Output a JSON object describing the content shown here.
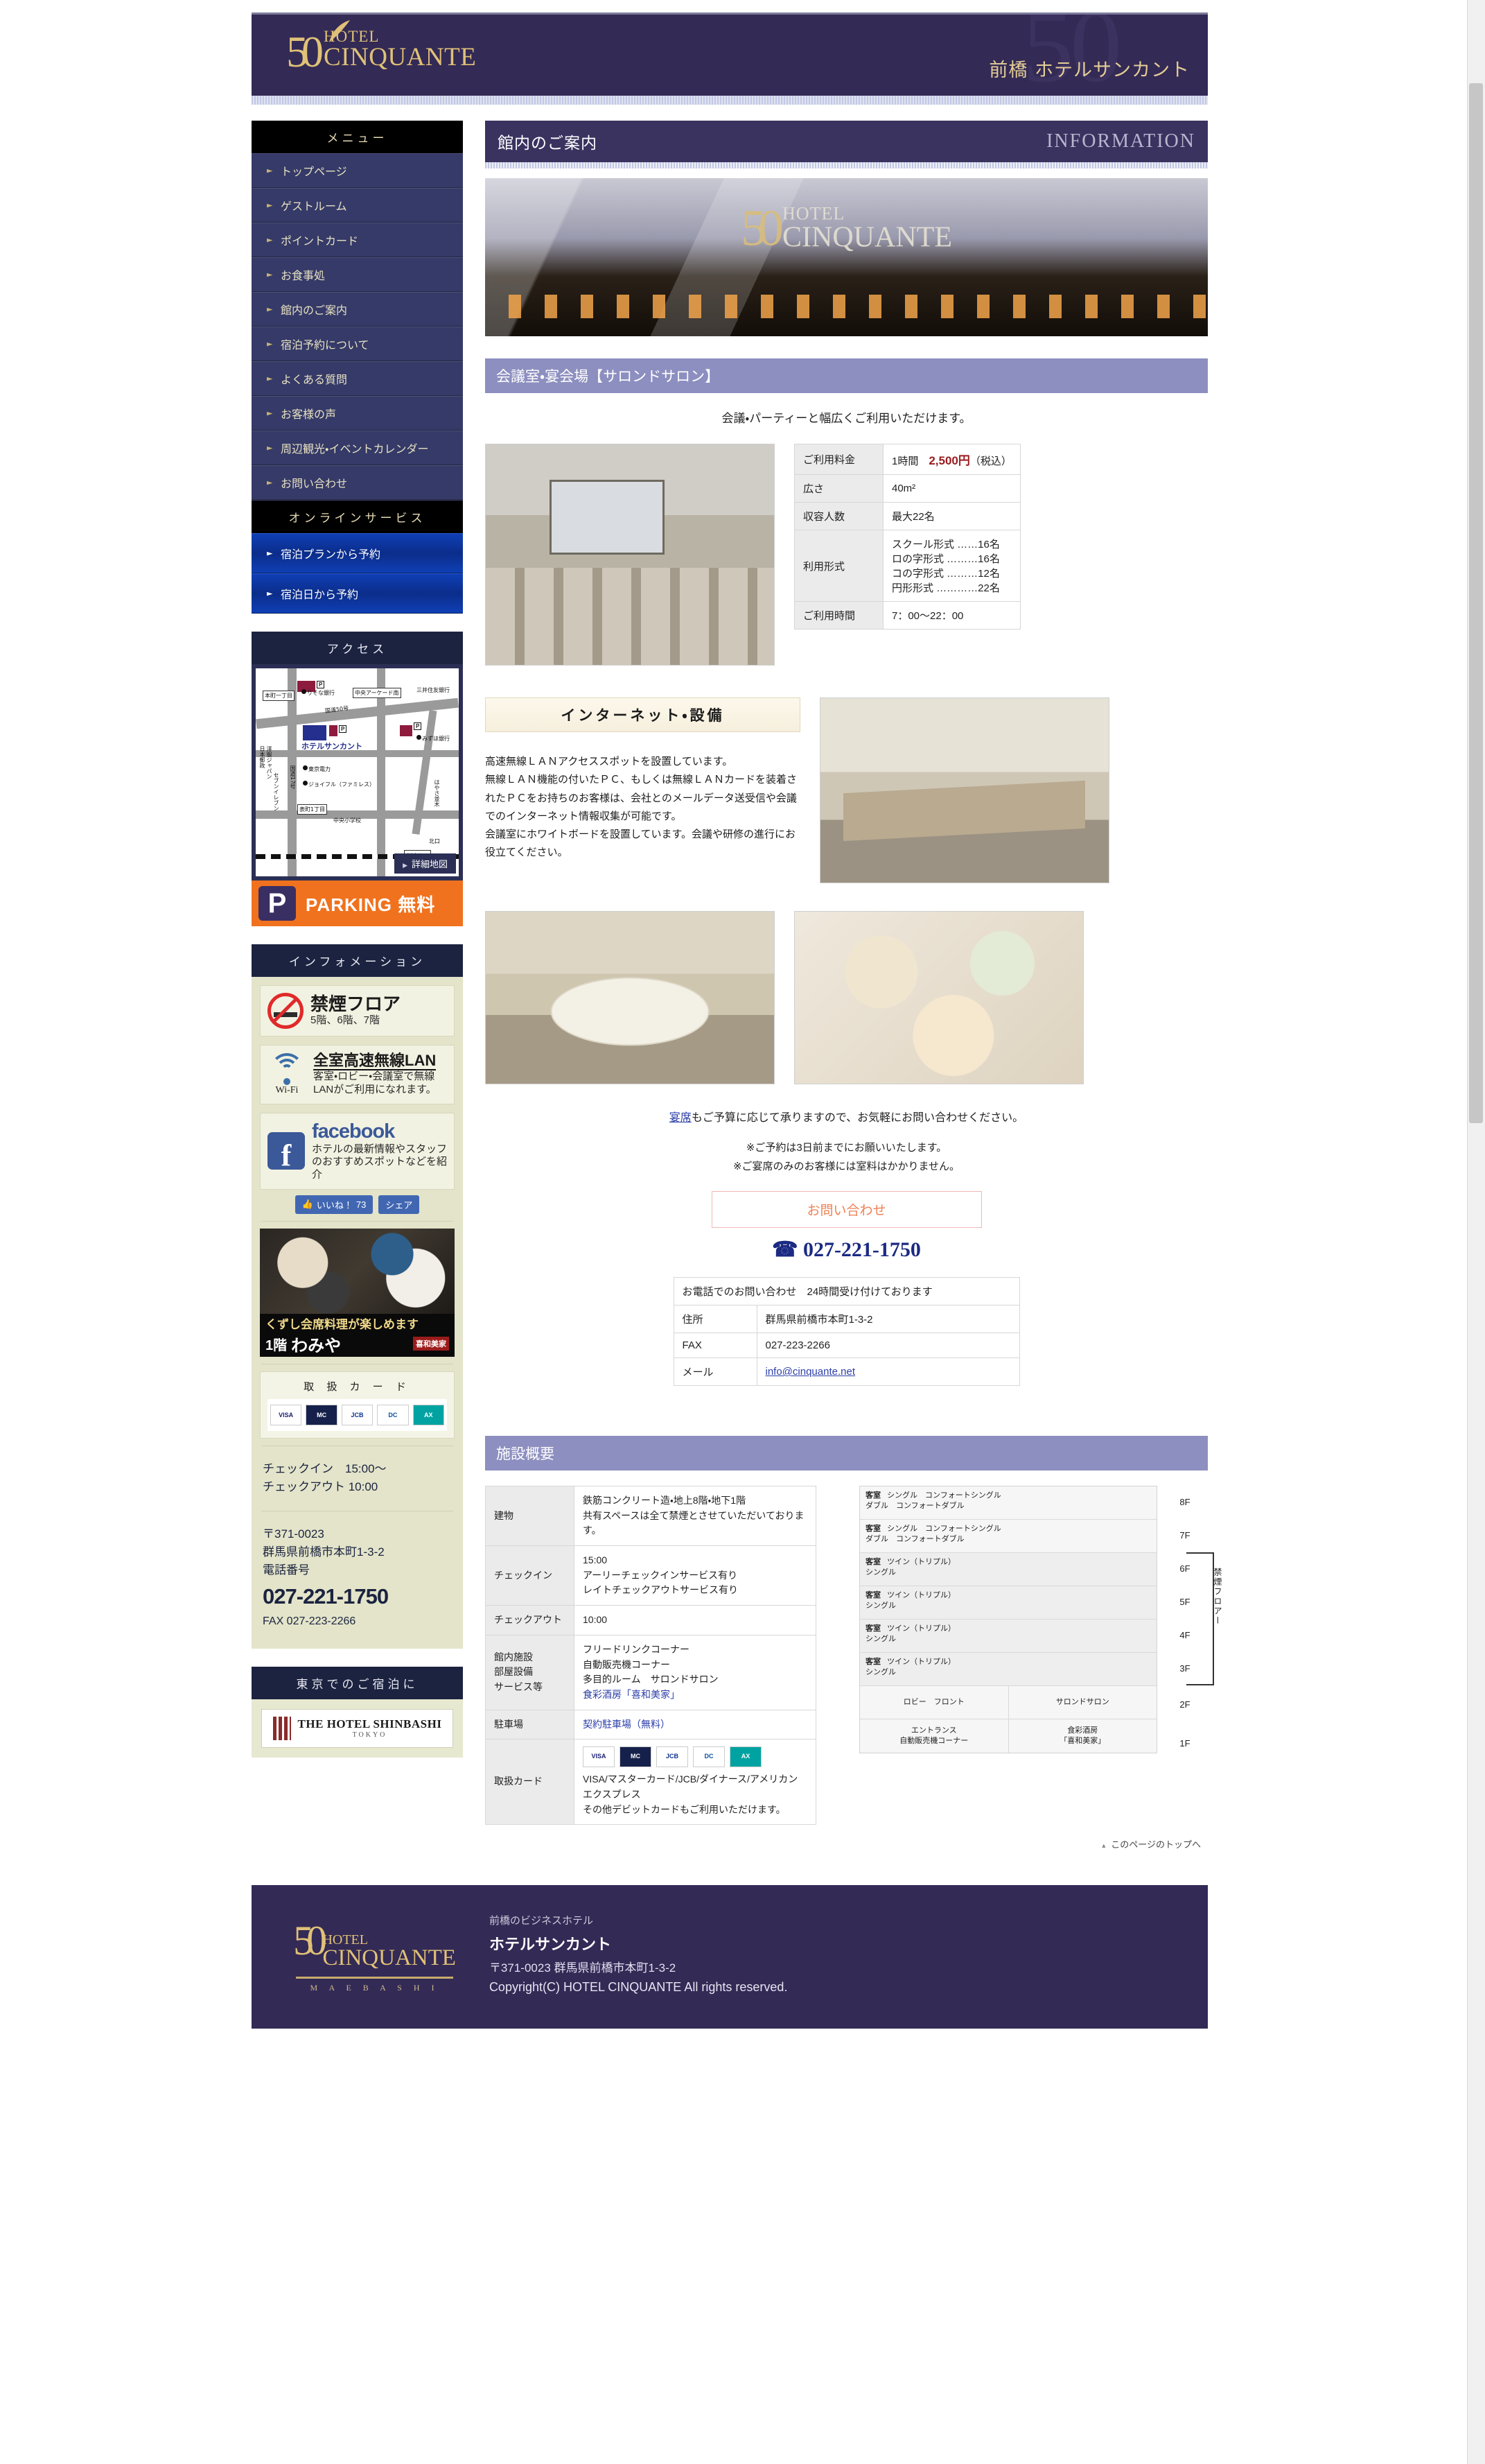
{
  "header": {
    "logo_line1": "HOTEL",
    "logo_line2": "CINQUANTE",
    "logo_mark": "50",
    "title": "前橋 ホテルサンカント"
  },
  "sidebar": {
    "menu_heading": "メニュー",
    "menu_items": [
      {
        "label": "トップページ"
      },
      {
        "label": "ゲストルーム"
      },
      {
        "label": "ポイントカード"
      },
      {
        "label": "お食事処"
      },
      {
        "label": "館内のご案内"
      },
      {
        "label": "宿泊予約について"
      },
      {
        "label": "よくある質問"
      },
      {
        "label": "お客様の声"
      },
      {
        "label": "周辺観光・イベントカレンダー"
      },
      {
        "label": "お問い合わせ"
      }
    ],
    "online_heading": "オンラインサービス",
    "online_items": [
      {
        "label": "宿泊プランから予約"
      },
      {
        "label": "宿泊日から予約"
      }
    ],
    "access_heading": "アクセス",
    "map": {
      "hotel_label": "ホテルサンカント",
      "labels": [
        "本町一丁目",
        "りそな銀行",
        "中央アーケード南",
        "三井住友銀行",
        "みずほ銀行",
        "国道50号",
        "国道17号",
        "東京電力",
        "ジョイフル（ファミレス）",
        "表町1丁目",
        "中央小学校",
        "前橋駅",
        "北口",
        "はやさ並木",
        "洋服ジャパン",
        "日本郵政",
        "セブンイレブン"
      ],
      "detail_button": "詳細地図",
      "parking_p": "P",
      "parking_label": "PARKING 無料"
    },
    "information_heading": "インフォメーション",
    "info_cards": [
      {
        "title": "禁煙フロア",
        "sub": "5階、6階、7階",
        "icon": "no-smoking-icon"
      },
      {
        "title": "全室高速無線LAN",
        "sub": "客室・ロビー・会議室で無線LANがご利用になれます。",
        "icon": "wifi-icon",
        "icon_label": "Wi-Fi"
      },
      {
        "title": "facebook",
        "sub": "ホテルの最新情報やスタッフのおすすめスポットなどを紹介",
        "icon": "facebook-icon"
      }
    ],
    "facebook_actions": {
      "like": "いいね！",
      "like_count": "73",
      "share": "シェア"
    },
    "promo": {
      "line1": "くずし会席料理が楽しめます",
      "floor": "1階",
      "shop": "わみや",
      "badge": "喜和美家"
    },
    "cards_heading": "取 扱 カ ー ド",
    "card_brands": [
      "VISA",
      "MasterCard",
      "JCB",
      "Diners Club",
      "AMEX"
    ],
    "checkin_line": "チェックイン　15:00～",
    "checkout_line": "チェックアウト 10:00",
    "postal": "〒371-0023",
    "address": "群馬県前橋市本町1-3-2",
    "tel_label": "電話番号",
    "tel": "027-221-1750",
    "fax": "FAX 027-223-2266",
    "tokyo_heading": "東京でのご宿泊に",
    "shinbashi_name": "THE HOTEL SHINBASHI",
    "shinbashi_sub": "TOKYO"
  },
  "main": {
    "banner_jp": "館内のご案内",
    "banner_en": "INFORMATION",
    "hero_logo1": "HOTEL",
    "hero_logo2": "CINQUANTE",
    "section_title": "会議室・宴会場【サロンドサロン】",
    "section_lead": "会議・パーティーと幅広くご利用いただけます。",
    "spec_rows": [
      {
        "key": "ご利用料金",
        "value_prefix": "1時間　",
        "value_red": "2,500円",
        "value_suffix": "（税込）"
      },
      {
        "key": "広さ",
        "value": "40m²"
      },
      {
        "key": "収容人数",
        "value": "最大22名"
      },
      {
        "key": "利用形式",
        "value_lines": [
          "スクール形式 ……16名",
          "ロの字形式 ………16名",
          "コの字形式 ………12名",
          "円形形式 …………22名"
        ]
      },
      {
        "key": "ご利用時間",
        "value": "7：00～22：00"
      }
    ],
    "internet_heading": "インターネット・設備",
    "internet_body": [
      "高速無線ＬＡＮアクセススポットを設置しています。",
      "無線ＬＡＮ機能の付いたＰＣ、もしくは無線ＬＡＮカードを装着されたＰＣをお持ちのお客様は、会社とのメールデータ送受信や会議でのインターネット情報収集が可能です。",
      "会議室にホワイトボードを設置しています。会議や研修の進行にお役立てください。"
    ],
    "banquet_note_link": "宴席",
    "banquet_note_rest": "もご予算に応じて承りますので、お気軽にお問い合わせください。",
    "notes": [
      "※ご予約は3日前までにお願いいたします。",
      "※ご宴席のみのお客様には室料はかかりません。"
    ],
    "contact_button": "お問い合わせ",
    "tel_big": "027-221-1750",
    "contact_table": {
      "caption": "お電話でのお問い合わせ　24時間受け付けております",
      "rows": [
        {
          "key": "住所",
          "value": "群馬県前橋市本町1-3-2",
          "link": false
        },
        {
          "key": "FAX",
          "value": "027-223-2266",
          "link": false
        },
        {
          "key": "メール",
          "value": "info@cinquante.net",
          "link": true
        }
      ]
    },
    "facility_title": "施設概要",
    "facility_rows": [
      {
        "key": "建物",
        "lines": [
          "鉄筋コンクリート造・地上8階・地下1階",
          "共有スペースは全て禁煙とさせていただいております。"
        ]
      },
      {
        "key": "チェックイン",
        "lines": [
          "15:00",
          "アーリーチェックインサービス有り",
          "レイトチェックアウトサービス有り"
        ]
      },
      {
        "key": "チェックアウト",
        "lines": [
          "10:00"
        ]
      },
      {
        "key": "館内施設\n部屋設備\nサービス等",
        "lines": [
          "フリードリンクコーナー",
          "自動販売機コーナー",
          "多目的ルーム　サロンドサロン",
          "食彩酒房「喜和美家」"
        ],
        "link_lines": [
          3
        ]
      },
      {
        "key": "駐車場",
        "lines": [
          "契約駐車場（無料）"
        ],
        "link_lines": [
          0
        ]
      },
      {
        "key": "取扱カード",
        "lines": [
          "VISA/マスターカード/JCB/ダイナース/アメリカンエクスプレス",
          "その他デビットカードもご利用いただけます。"
        ],
        "has_card_icons": true
      }
    ],
    "floor_plan": {
      "floors": [
        {
          "num": "8F",
          "tag": "客室",
          "text": "シングル　コンフォートシングル\nダブル　コンフォートダブル"
        },
        {
          "num": "7F",
          "tag": "客室",
          "text": "シングル　コンフォートシングル\nダブル　コンフォートダブル"
        },
        {
          "num": "6F",
          "tag": "客室",
          "text": "ツイン（トリプル）\nシングル"
        },
        {
          "num": "5F",
          "tag": "客室",
          "text": "ツイン（トリプル）\nシングル"
        },
        {
          "num": "4F",
          "tag": "客室",
          "text": "ツイン（トリプル）\nシングル"
        },
        {
          "num": "3F",
          "tag": "客室",
          "text": "ツイン（トリプル）\nシングル"
        },
        {
          "num": "2F",
          "tag": "",
          "text": "ロビー　フロント",
          "text2": "サロンドサロン"
        },
        {
          "num": "1F",
          "tag": "",
          "text": "エントランス\n自動販売機コーナー",
          "text2": "食彩酒房\n「喜和美家」"
        }
      ],
      "smoke_label": "禁煙フロアー"
    },
    "back_to_top": "このページのトップへ"
  },
  "footer": {
    "logo1": "HOTEL",
    "logo2": "CINQUANTE",
    "maebashi": "M A E B A S H I",
    "tagline": "前橋のビジネスホテル",
    "name": "ホテルサンカント",
    "address": "〒371-0023 群馬県前橋市本町1-3-2",
    "copyright": "Copyright(C) HOTEL CINQUANTE All rights reserved."
  }
}
